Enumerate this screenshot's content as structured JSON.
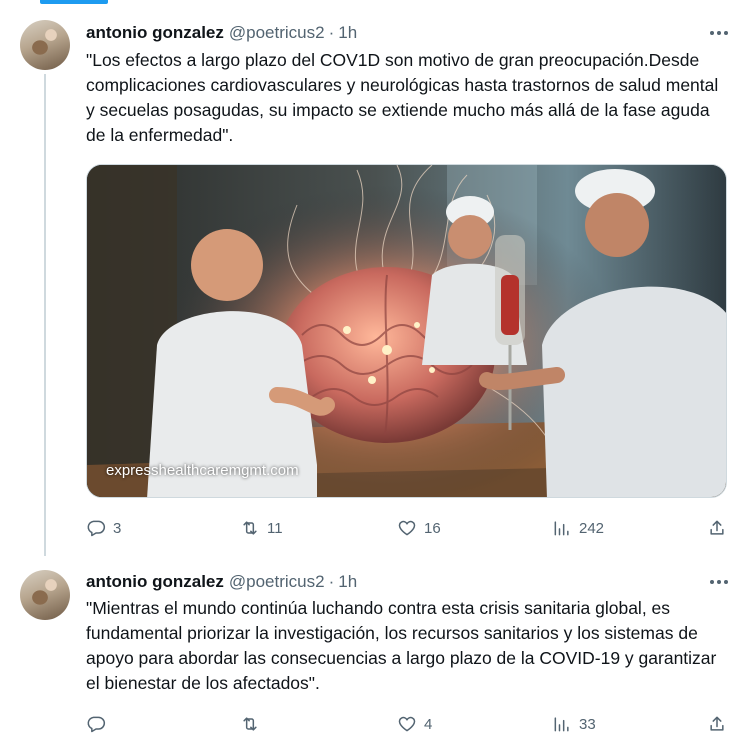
{
  "tweets": [
    {
      "author_name": "antonio gonzalez",
      "handle": "@poetricus2",
      "separator": "·",
      "time": "1h",
      "text": "\"Los efectos a largo plazo del COV1D son motivo de gran preocupación.Desde complicaciones cardiovasculares y neurológicas hasta trastornos de salud mental y secuelas posagudas, su impacto se extiende mucho más allá de la fase aguda de la enfermedad\".",
      "media_caption": "expresshealthcaremgmt.com",
      "replies": "3",
      "retweets": "11",
      "likes": "16",
      "views": "242"
    },
    {
      "author_name": "antonio gonzalez",
      "handle": "@poetricus2",
      "separator": "·",
      "time": "1h",
      "text": "\"Mientras el mundo continúa luchando contra esta crisis sanitaria global, es fundamental priorizar la investigación, los recursos sanitarios y los sistemas de apoyo para abordar las consecuencias a largo plazo de la COVID-19 y garantizar el bienestar de los afectados\".",
      "replies": "",
      "retweets": "",
      "likes": "4",
      "views": "33"
    }
  ],
  "icons": {
    "reply": "speech-bubble-icon",
    "retweet": "retweet-arrows-icon",
    "like": "heart-icon",
    "views": "bar-chart-icon",
    "share": "share-upload-icon",
    "more": "more-dots-icon"
  },
  "colors": {
    "accent": "#1d9bf0",
    "text": "#0f1419",
    "secondary": "#536471",
    "divider": "#cfd9de"
  }
}
